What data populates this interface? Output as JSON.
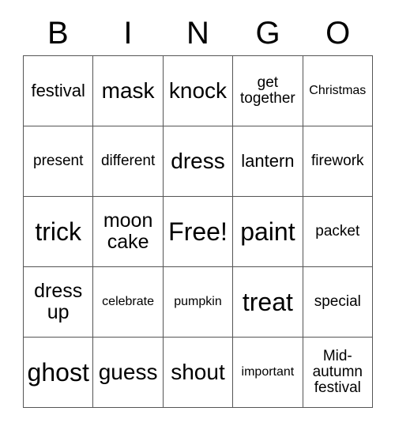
{
  "card": {
    "title_letters": [
      "B",
      "I",
      "N",
      "G",
      "O"
    ],
    "rows": [
      [
        {
          "text": "festival",
          "size": "sm"
        },
        {
          "text": "mask",
          "size": "lg"
        },
        {
          "text": "knock",
          "size": "lg"
        },
        {
          "text": "get together",
          "size": "xs"
        },
        {
          "text": "Christmas",
          "size": "xxs"
        }
      ],
      [
        {
          "text": "present",
          "size": "xs"
        },
        {
          "text": "different",
          "size": "xs"
        },
        {
          "text": "dress",
          "size": "lg"
        },
        {
          "text": "lantern",
          "size": "sm"
        },
        {
          "text": "firework",
          "size": "xs"
        }
      ],
      [
        {
          "text": "trick",
          "size": "xl"
        },
        {
          "text": "moon cake",
          "size": "md"
        },
        {
          "text": "Free!",
          "size": "xl"
        },
        {
          "text": "paint",
          "size": "xl"
        },
        {
          "text": "packet",
          "size": "xs"
        }
      ],
      [
        {
          "text": "dress up",
          "size": "md"
        },
        {
          "text": "celebrate",
          "size": "xxs"
        },
        {
          "text": "pumpkin",
          "size": "xxs"
        },
        {
          "text": "treat",
          "size": "xl"
        },
        {
          "text": "special",
          "size": "xs"
        }
      ],
      [
        {
          "text": "ghost",
          "size": "xl"
        },
        {
          "text": "guess",
          "size": "lg"
        },
        {
          "text": "shout",
          "size": "lg"
        },
        {
          "text": "important",
          "size": "xxs"
        },
        {
          "text": "Mid-autumn festival",
          "size": "xs"
        }
      ]
    ],
    "free_space_label": "Free!",
    "border_color": "#555555",
    "text_color": "#000000",
    "background_color": "#ffffff"
  }
}
